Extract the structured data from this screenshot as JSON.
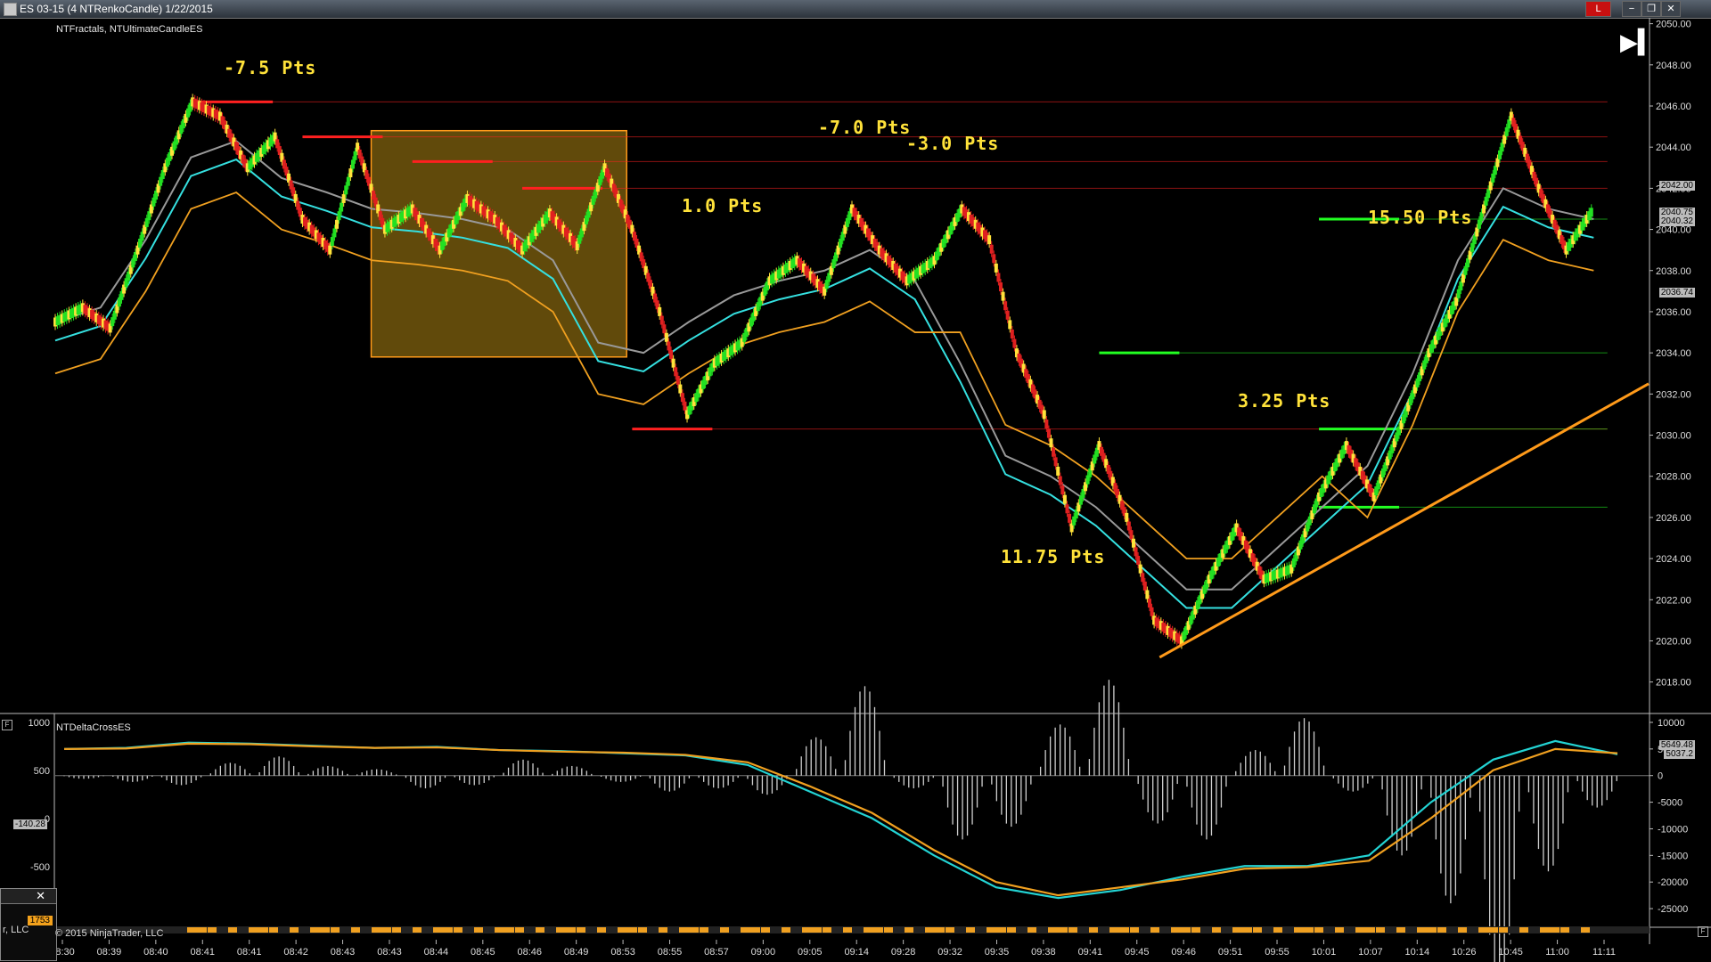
{
  "window": {
    "title": "ES 03-15 (4 NTRenkoCandle)  1/22/2015",
    "controls": [
      "L",
      "−",
      "❐",
      "✕"
    ]
  },
  "panels": {
    "price_label": "NTFractals, NTUltimateCandleES",
    "indicator_label": "NTDeltaCrossES"
  },
  "annotations": [
    {
      "text": "-7.5 Pts"
    },
    {
      "text": "-7.0 Pts"
    },
    {
      "text": "-3.0 Pts"
    },
    {
      "text": "1.0 Pts"
    },
    {
      "text": "15.50 Pts"
    },
    {
      "text": "3.25 Pts"
    },
    {
      "text": "11.75 Pts"
    }
  ],
  "price_tags": [
    "2042.00",
    "2040.75",
    "2040.32",
    "2036.74"
  ],
  "indicator_tags": [
    "5649.48",
    "5037.2"
  ],
  "left_tag": "-140.28",
  "mini_window": {
    "badge": "1753",
    "text": "r, LLC"
  },
  "footer_text": "© 2015 NinjaTrader, LLC",
  "chart_data": [
    {
      "type": "candlestick",
      "title": "ES 03-15 (4 NTRenkoCandle)",
      "y_axis": {
        "ticks": [
          "2050.00",
          "2048.00",
          "2046.00",
          "2044.00",
          "2042.00",
          "2040.00",
          "2038.00",
          "2036.00",
          "2034.00",
          "2032.00",
          "2030.00",
          "2028.00",
          "2026.00",
          "2024.00",
          "2022.00",
          "2020.00",
          "2018.00"
        ],
        "min": 2016.6,
        "max": 2050.2
      },
      "x_axis": {
        "ticks": [
          "08:30",
          "08:39",
          "08:40",
          "08:41",
          "08:41",
          "08:42",
          "08:43",
          "08:43",
          "08:44",
          "08:45",
          "08:46",
          "08:49",
          "08:53",
          "08:55",
          "08:57",
          "09:00",
          "09:05",
          "09:14",
          "09:28",
          "09:32",
          "09:35",
          "09:38",
          "09:41",
          "09:45",
          "09:46",
          "09:51",
          "09:55",
          "10:01",
          "10:07",
          "10:14",
          "10:26",
          "10:45",
          "11:00",
          "11:11"
        ]
      },
      "price_path": [
        [
          0,
          2035.5
        ],
        [
          1,
          2036.2
        ],
        [
          2,
          2035.2
        ],
        [
          3,
          2039.0
        ],
        [
          4,
          2043.0
        ],
        [
          5,
          2046.2
        ],
        [
          6,
          2045.5
        ],
        [
          7,
          2043.0
        ],
        [
          8,
          2044.5
        ],
        [
          9,
          2040.5
        ],
        [
          10,
          2039.0
        ],
        [
          11,
          2044.0
        ],
        [
          12,
          2040.0
        ],
        [
          13,
          2041.0
        ],
        [
          14,
          2039.0
        ],
        [
          15,
          2041.5
        ],
        [
          16,
          2040.5
        ],
        [
          17,
          2039.0
        ],
        [
          18,
          2040.8
        ],
        [
          19,
          2039.2
        ],
        [
          20,
          2043.0
        ],
        [
          21,
          2040.0
        ],
        [
          22,
          2036.0
        ],
        [
          23,
          2031.0
        ],
        [
          24,
          2033.5
        ],
        [
          25,
          2034.5
        ],
        [
          26,
          2037.5
        ],
        [
          27,
          2038.5
        ],
        [
          28,
          2037.0
        ],
        [
          29,
          2041.0
        ],
        [
          30,
          2039.0
        ],
        [
          31,
          2037.5
        ],
        [
          32,
          2038.5
        ],
        [
          33,
          2041.0
        ],
        [
          34,
          2039.5
        ],
        [
          35,
          2034.0
        ],
        [
          36,
          2031.0
        ],
        [
          37,
          2025.5
        ],
        [
          38,
          2029.5
        ],
        [
          39,
          2026.0
        ],
        [
          40,
          2021.0
        ],
        [
          41,
          2020.0
        ],
        [
          42,
          2023.0
        ],
        [
          43,
          2025.5
        ],
        [
          44,
          2023.0
        ],
        [
          45,
          2023.5
        ],
        [
          46,
          2027.0
        ],
        [
          47,
          2029.5
        ],
        [
          48,
          2027.0
        ],
        [
          49,
          2030.5
        ],
        [
          50,
          2034.0
        ],
        [
          51,
          2036.5
        ],
        [
          52,
          2041.0
        ],
        [
          53,
          2045.5
        ],
        [
          54,
          2042.0
        ],
        [
          55,
          2039.0
        ],
        [
          56,
          2041.0
        ]
      ],
      "fast_ema": [
        2035.5,
        2036.2,
        2039.5,
        2043.5,
        2044.3,
        2042.5,
        2041.8,
        2041.0,
        2040.8,
        2040.5,
        2040.0,
        2038.5,
        2034.5,
        2034.0,
        2035.5,
        2036.8,
        2037.5,
        2038.0,
        2039.0,
        2037.5,
        2033.5,
        2029.0,
        2028.0,
        2026.5,
        2024.5,
        2022.5,
        2022.5,
        2024.5,
        2026.5,
        2028.5,
        2033.0,
        2038.5,
        2042.0,
        2041.0,
        2040.5
      ],
      "trend_lines": [
        {
          "name": "support",
          "from": [
            40.2,
            2019.2
          ],
          "to": [
            58,
            2032.5
          ],
          "color": "#ff9a1a"
        }
      ],
      "levels": [
        {
          "price": 2046.2,
          "color": "#ff2020"
        },
        {
          "price": 2044.5,
          "color": "#ff2020"
        },
        {
          "price": 2043.3,
          "color": "#ff2020"
        },
        {
          "price": 2042.0,
          "color": "#ff2020"
        },
        {
          "price": 2030.3,
          "color": "#ff2020"
        },
        {
          "price": 2040.5,
          "color": "#22ff22"
        },
        {
          "price": 2034.0,
          "color": "#22ff22"
        },
        {
          "price": 2030.3,
          "color": "#22ff22"
        },
        {
          "price": 2026.5,
          "color": "#22ff22"
        }
      ],
      "highlight_box": {
        "x_from": 11.5,
        "x_to": 20.8,
        "y_from": 2033.8,
        "y_to": 2044.8
      }
    },
    {
      "type": "line",
      "title": "NTDeltaCrossES",
      "y_axis": {
        "ticks": [
          "10000",
          "5000",
          "0",
          "-5000",
          "-10000",
          "-15000",
          "-20000",
          "-25000"
        ],
        "min": -28000,
        "max": 11000
      },
      "left_axis_ticks": [
        "1000",
        "500",
        "0",
        "-500"
      ],
      "series": [
        {
          "name": "",
          "color": "#23d3d3",
          "values": [
            5000,
            5200,
            6200,
            6000,
            5600,
            5200,
            5400,
            4800,
            4600,
            4200,
            3800,
            2000,
            -3000,
            -8000,
            -15000,
            -21000,
            -23000,
            -21500,
            -19000,
            -17000,
            -17000,
            -15000,
            -5000,
            3000,
            6500,
            4000
          ]
        },
        {
          "name": "",
          "color": "#f0a020",
          "values": [
            5000,
            5100,
            6000,
            5900,
            5500,
            5200,
            5300,
            4800,
            4500,
            4300,
            3900,
            2500,
            -2000,
            -7000,
            -14000,
            -20000,
            -22500,
            -21000,
            -19500,
            -17500,
            -17200,
            -16000,
            -8000,
            1000,
            5000,
            4200
          ]
        }
      ],
      "histogram": [
        -100,
        -200,
        -300,
        400,
        600,
        300,
        200,
        -400,
        -300,
        500,
        300,
        -200,
        -500,
        -400,
        -600,
        1200,
        2800,
        -400,
        -2000,
        -1600,
        1600,
        3000,
        -1500,
        -2000,
        800,
        1800,
        -500,
        -2500,
        -4000,
        -6500,
        -3000,
        -1000
      ]
    }
  ]
}
